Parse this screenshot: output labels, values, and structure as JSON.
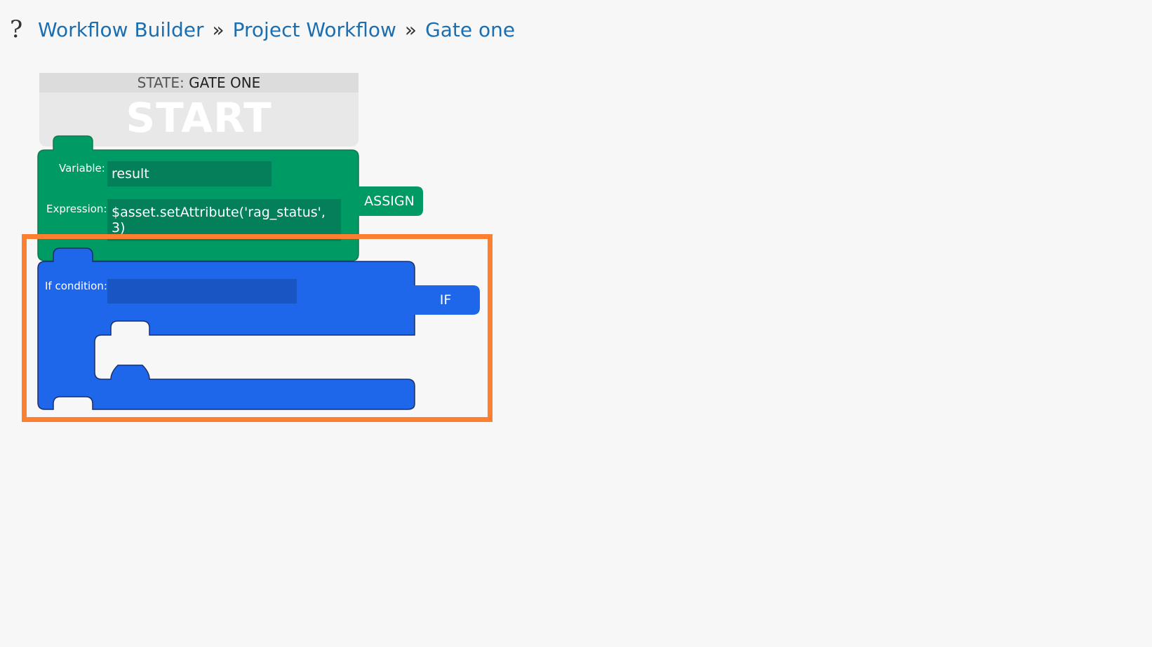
{
  "breadcrumb": {
    "help_icon": "?",
    "items": [
      "Workflow Builder",
      "Project Workflow",
      "Gate one"
    ],
    "separator": "»"
  },
  "start_block": {
    "state_label": "STATE:",
    "state_name": "GATE ONE",
    "title": "START"
  },
  "assign_block": {
    "variable_label": "Variable:",
    "variable_value": "result",
    "expression_label": "Expression:",
    "expression_value": "$asset.setAttribute('rag_status', 3)",
    "tab_label": "ASSIGN",
    "color": "#009b65"
  },
  "if_block": {
    "condition_label": "If condition:",
    "condition_value": "",
    "tab_label": "IF",
    "color": "#1e66ea"
  },
  "highlight_color": "#fc8030"
}
